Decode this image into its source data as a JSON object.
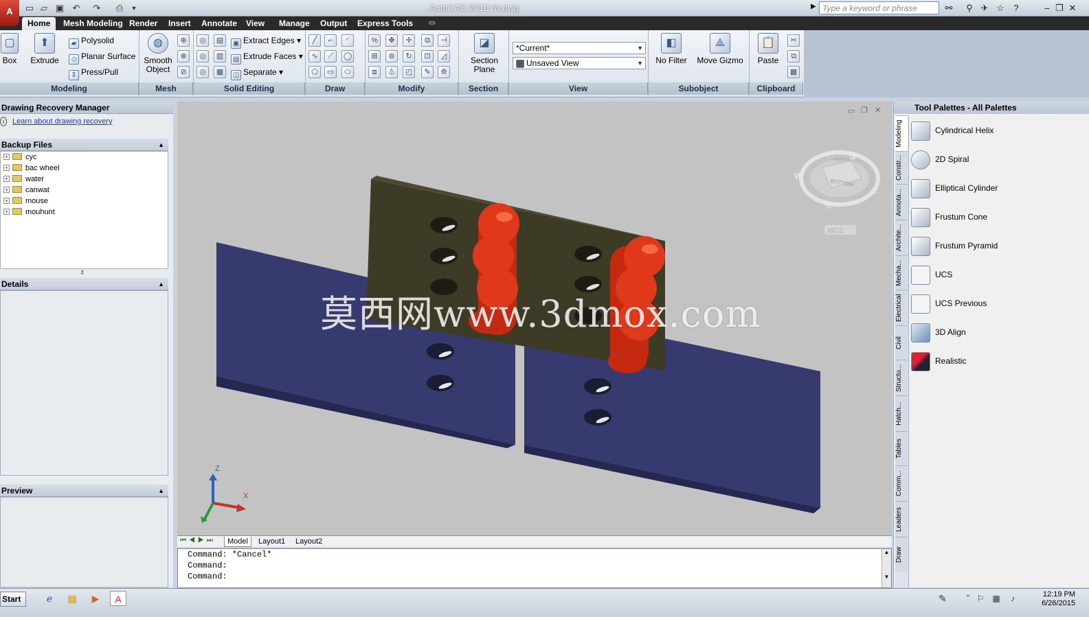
{
  "title": "AutoCAD 2010   riv.dwg",
  "app_button": "A",
  "search": {
    "placeholder": "Type a keyword or phrase"
  },
  "tabs": [
    "Home",
    "Mesh Modeling",
    "Render",
    "Insert",
    "Annotate",
    "View",
    "Manage",
    "Output",
    "Express Tools"
  ],
  "ribbon": {
    "modeling": {
      "box": "Box",
      "extrude": "Extrude",
      "polysolid": "Polysolid",
      "planar_surface": "Planar Surface",
      "presspull": "Press/Pull",
      "label": "Modeling"
    },
    "mesh": {
      "smooth_object_1": "Smooth",
      "smooth_object_2": "Object",
      "label": "Mesh"
    },
    "solid_editing": {
      "extract_edges": "Extract Edges",
      "extrude_faces": "Extrude Faces",
      "separate": "Separate",
      "label": "Solid Editing"
    },
    "draw": {
      "label": "Draw"
    },
    "modify": {
      "label": "Modify"
    },
    "section": {
      "section_plane_1": "Section",
      "section_plane_2": "Plane",
      "label": "Section"
    },
    "view": {
      "visual_style": "*Current*",
      "named_view": "Unsaved View",
      "label": "View"
    },
    "subobject": {
      "no_filter": "No Filter",
      "move_gizmo": "Move Gizmo",
      "label": "Subobject"
    },
    "clipboard": {
      "paste": "Paste",
      "label": "Clipboard"
    }
  },
  "recovery": {
    "title": "Drawing Recovery Manager",
    "link": "Learn about drawing recovery",
    "backup_header": "Backup Files",
    "files": [
      "cyc",
      "bac wheel",
      "water",
      "canwat",
      "mouse",
      "mouhunt"
    ],
    "details_header": "Details",
    "preview_header": "Preview"
  },
  "viewcube": {
    "top": "BOTTOM",
    "front": "FRONT",
    "s": "S",
    "w": "W",
    "e": "E",
    "n": "N",
    "wcs": "WCS"
  },
  "ucs": {
    "x": "X",
    "y": "Y",
    "z": "Z"
  },
  "watermark": "莫西网www.3dmox.com",
  "layout_tabs": [
    "Model",
    "Layout1",
    "Layout2"
  ],
  "command_lines": [
    "Command: *Cancel*",
    "Command:",
    "Command:"
  ],
  "palette": {
    "title": "Tool Palettes - All Palettes",
    "tabs": [
      "Modeling",
      "Constr...",
      "Annota...",
      "Archite...",
      "Mecha...",
      "Electrical",
      "Civil",
      "Structu...",
      "Hatch...",
      "Tables",
      "Comm...",
      "Leaders",
      "Draw"
    ],
    "items": [
      "Cylindrical Helix",
      "2D Spiral",
      "Elliptical Cylinder",
      "Frustum Cone",
      "Frustum Pyramid",
      "UCS",
      "UCS Previous",
      "3D Align",
      "Realistic"
    ]
  },
  "taskbar": {
    "start": "Start",
    "time": "12:19 PM",
    "date": "6/26/2015"
  },
  "colors": {
    "plate_blue": "#363a6e",
    "plate_brown": "#3d3a26",
    "rivet_red": "#e0381a",
    "viewport_bg": "#c3c3c3",
    "tab_bar": "#2a2a2a"
  }
}
